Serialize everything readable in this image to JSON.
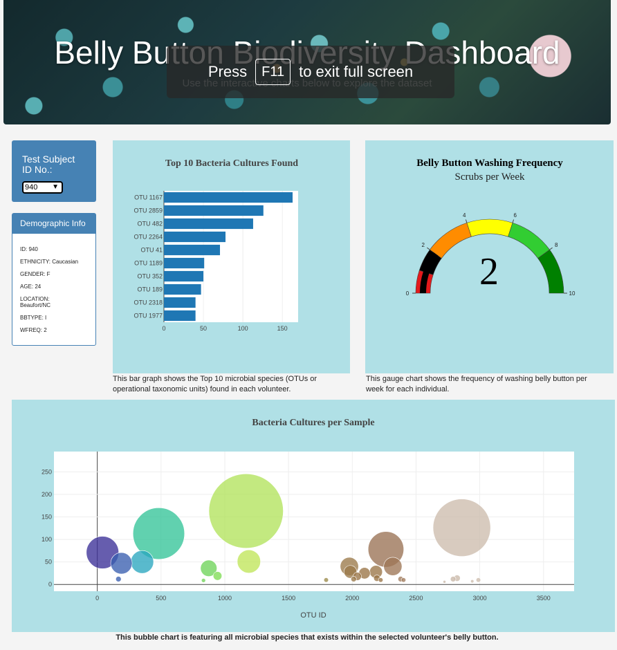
{
  "banner": {
    "title": "Belly Button Biodiversity Dashboard",
    "subtitle": "Use the interactive charts below to explore the dataset",
    "fullscreen_press": "Press",
    "fullscreen_key": "F11",
    "fullscreen_msg": "to exit full screen"
  },
  "selector": {
    "label_line1": "Test Subject",
    "label_line2": "ID No.:",
    "value": "940",
    "chevron": "chevron-down-icon"
  },
  "demographic": {
    "title": "Demographic Info",
    "items": [
      "ID: 940",
      "ETHNICITY: Caucasian",
      "GENDER: F",
      "AGE: 24",
      "LOCATION: Beaufort/NC",
      "BBTYPE: I",
      "WFREQ: 2"
    ]
  },
  "bar_caption": "This bar graph shows the Top 10 microbial species (OTUs or operational taxonomic units) found in each volunteer.",
  "gauge_caption": "This gauge chart shows the frequency of washing belly button per week for each individual.",
  "bubble_caption": "This bubble chart is featuring all microbial species that exists within the selected volunteer's belly button.",
  "colors": {
    "card_bg": "#b0e0e6",
    "panel_blue": "#4682b4",
    "bar_blue": "#1f77b4"
  },
  "chart_data": [
    {
      "type": "bar",
      "orientation": "horizontal",
      "title": "Top 10 Bacteria Cultures Found",
      "categories": [
        "OTU 1167",
        "OTU 2859",
        "OTU 482",
        "OTU 2264",
        "OTU 41",
        "OTU 1189",
        "OTU 352",
        "OTU 189",
        "OTU 2318",
        "OTU 1977"
      ],
      "values": [
        163,
        126,
        113,
        78,
        71,
        51,
        50,
        47,
        40,
        40
      ],
      "xlim": [
        0,
        170
      ],
      "xticks": [
        0,
        50,
        100,
        150
      ],
      "grid": true
    },
    {
      "type": "gauge",
      "title": "Belly Button Washing Frequency",
      "subtitle": "Scrubs per Week",
      "value": 2,
      "range": [
        0,
        10
      ],
      "ticks": [
        0,
        2,
        4,
        6,
        8,
        10
      ],
      "bands": [
        {
          "from": 0,
          "to": 1,
          "color": "#e31a1c"
        },
        {
          "from": 1,
          "to": 2,
          "color": "#000000"
        },
        {
          "from": 2,
          "to": 4,
          "color": "#ff8c00"
        },
        {
          "from": 4,
          "to": 6,
          "color": "#ffff00"
        },
        {
          "from": 6,
          "to": 8,
          "color": "#32cd32"
        },
        {
          "from": 8,
          "to": 10,
          "color": "#008000"
        }
      ]
    },
    {
      "type": "scatter",
      "style": "bubble",
      "title": "Bacteria Cultures per Sample",
      "xlabel": "OTU ID",
      "ylabel": "",
      "xlim": [
        -340,
        3740
      ],
      "ylim": [
        -15,
        295
      ],
      "xticks": [
        0,
        500,
        1000,
        1500,
        2000,
        2500,
        3000,
        3500
      ],
      "yticks": [
        0,
        50,
        100,
        150,
        200,
        250
      ],
      "grid": true,
      "points": [
        {
          "x": 41,
          "y": 71,
          "size": 71,
          "color": "#3b2f97"
        },
        {
          "x": 189,
          "y": 47,
          "size": 47,
          "color": "#3a5fb0"
        },
        {
          "x": 166,
          "y": 12,
          "size": 12,
          "color": "#3a5fb0"
        },
        {
          "x": 352,
          "y": 50,
          "size": 50,
          "color": "#2aa6bf"
        },
        {
          "x": 482,
          "y": 113,
          "size": 113,
          "color": "#35c499"
        },
        {
          "x": 874,
          "y": 36,
          "size": 36,
          "color": "#6ed45a"
        },
        {
          "x": 943,
          "y": 19,
          "size": 19,
          "color": "#7fdc55"
        },
        {
          "x": 833,
          "y": 9,
          "size": 9,
          "color": "#72d458"
        },
        {
          "x": 1167,
          "y": 163,
          "size": 163,
          "color": "#b2e35c"
        },
        {
          "x": 1189,
          "y": 51,
          "size": 51,
          "color": "#c0e65a"
        },
        {
          "x": 1795,
          "y": 10,
          "size": 10,
          "color": "#9b8a4a"
        },
        {
          "x": 1977,
          "y": 40,
          "size": 40,
          "color": "#9b7a4a"
        },
        {
          "x": 1985,
          "y": 28,
          "size": 28,
          "color": "#9b7a4a"
        },
        {
          "x": 2011,
          "y": 12,
          "size": 12,
          "color": "#9b7a4a"
        },
        {
          "x": 2039,
          "y": 18,
          "size": 18,
          "color": "#9a7447"
        },
        {
          "x": 2096,
          "y": 25,
          "size": 25,
          "color": "#9a7447"
        },
        {
          "x": 2186,
          "y": 28,
          "size": 28,
          "color": "#9a7447"
        },
        {
          "x": 2193,
          "y": 14,
          "size": 14,
          "color": "#9a7447"
        },
        {
          "x": 2223,
          "y": 10,
          "size": 10,
          "color": "#9a7447"
        },
        {
          "x": 2264,
          "y": 78,
          "size": 78,
          "color": "#9a7254"
        },
        {
          "x": 2318,
          "y": 40,
          "size": 40,
          "color": "#9e7656"
        },
        {
          "x": 2380,
          "y": 12,
          "size": 12,
          "color": "#a27c5e"
        },
        {
          "x": 2402,
          "y": 10,
          "size": 10,
          "color": "#a27c5e"
        },
        {
          "x": 2723,
          "y": 6,
          "size": 6,
          "color": "#c9b7a8"
        },
        {
          "x": 2791,
          "y": 12,
          "size": 12,
          "color": "#c9b7a8"
        },
        {
          "x": 2822,
          "y": 14,
          "size": 14,
          "color": "#cbbaaa"
        },
        {
          "x": 2859,
          "y": 126,
          "size": 126,
          "color": "#cdbdad"
        },
        {
          "x": 2941,
          "y": 7,
          "size": 7,
          "color": "#cdbdad"
        },
        {
          "x": 2989,
          "y": 10,
          "size": 10,
          "color": "#cdbdad"
        }
      ]
    }
  ]
}
